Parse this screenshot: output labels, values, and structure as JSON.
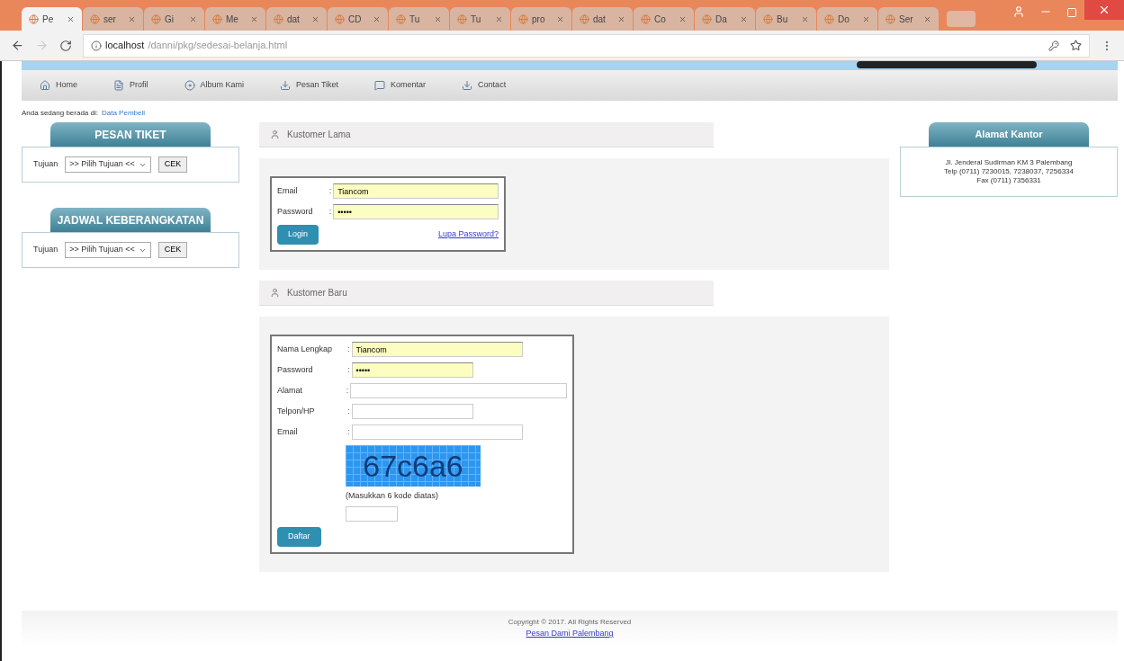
{
  "browser": {
    "tabs": [
      {
        "label": "Pe",
        "selected": true
      },
      {
        "label": "ser",
        "selected": false
      },
      {
        "label": "Gi",
        "selected": false
      },
      {
        "label": "Me",
        "selected": false
      },
      {
        "label": "dat",
        "selected": false
      },
      {
        "label": "CD",
        "selected": false
      },
      {
        "label": "Tu",
        "selected": false
      },
      {
        "label": "Tu",
        "selected": false
      },
      {
        "label": "pro",
        "selected": false
      },
      {
        "label": "dat",
        "selected": false
      },
      {
        "label": "Co",
        "selected": false
      },
      {
        "label": "Da",
        "selected": false
      },
      {
        "label": "Bu",
        "selected": false
      },
      {
        "label": "Do",
        "selected": false
      },
      {
        "label": "Ser",
        "selected": false
      }
    ],
    "address": {
      "host": "localhost",
      "path": "/danni/pkg/sedesai-belanja.html"
    }
  },
  "nav": {
    "items": [
      {
        "label": "Home"
      },
      {
        "label": "Profil"
      },
      {
        "label": "Album Kami"
      },
      {
        "label": "Pesan Tiket"
      },
      {
        "label": "Komentar"
      },
      {
        "label": "Contact"
      }
    ]
  },
  "breadcrumb": {
    "prefix": "Anda sedang berada di:",
    "link": "Data Pembeli"
  },
  "sidebar": [
    {
      "title": "PESAN TIKET",
      "label": "Tujuan",
      "select": ">> Pilih Tujuan <<",
      "button": "CEK"
    },
    {
      "title": "JADWAL KEBERANGKATAN",
      "label": "Tujuan",
      "select": ">> Pilih Tujuan <<",
      "button": "CEK"
    }
  ],
  "login": {
    "title": "Kustomer Lama",
    "fields": [
      {
        "label": "Email",
        "colon": ":",
        "value": "Tiancom",
        "filled": true,
        "kind": "long"
      },
      {
        "label": "Password",
        "colon": ":",
        "value": "•••••",
        "filled": true,
        "kind": "long"
      }
    ],
    "button": "Login",
    "link": "Lupa Password?"
  },
  "register": {
    "title": "Kustomer Baru",
    "fields": [
      {
        "label": "Nama Lengkap",
        "colon": ":",
        "value": "Tiancom",
        "filled": true,
        "kind": "medium"
      },
      {
        "label": "Password",
        "colon": ":",
        "value": "•••••",
        "filled": true,
        "kind": "short"
      },
      {
        "label": "Alamat",
        "colon": ":",
        "filled": false,
        "kind": "long"
      },
      {
        "label": "Telpon/HP",
        "colon": ":",
        "filled": false,
        "kind": "short"
      },
      {
        "label": "Email",
        "colon": ":",
        "filled": false,
        "kind": "medium"
      }
    ],
    "captcha": "67c6a6",
    "hint": "(Masukkan 6 kode diatas)",
    "button": "Daftar"
  },
  "office": {
    "title": "Alamat Kantor",
    "lines": [
      "Jl. Jenderal Sudirman KM 3 Palembang",
      "Telp (0711) 7230015, 7238037, 7256334",
      "Fax (0711) 7356331"
    ]
  },
  "footer": {
    "copyright": "Copyright © 2017. All Rights Reserved",
    "link": "Pesan Dami Palembang"
  }
}
